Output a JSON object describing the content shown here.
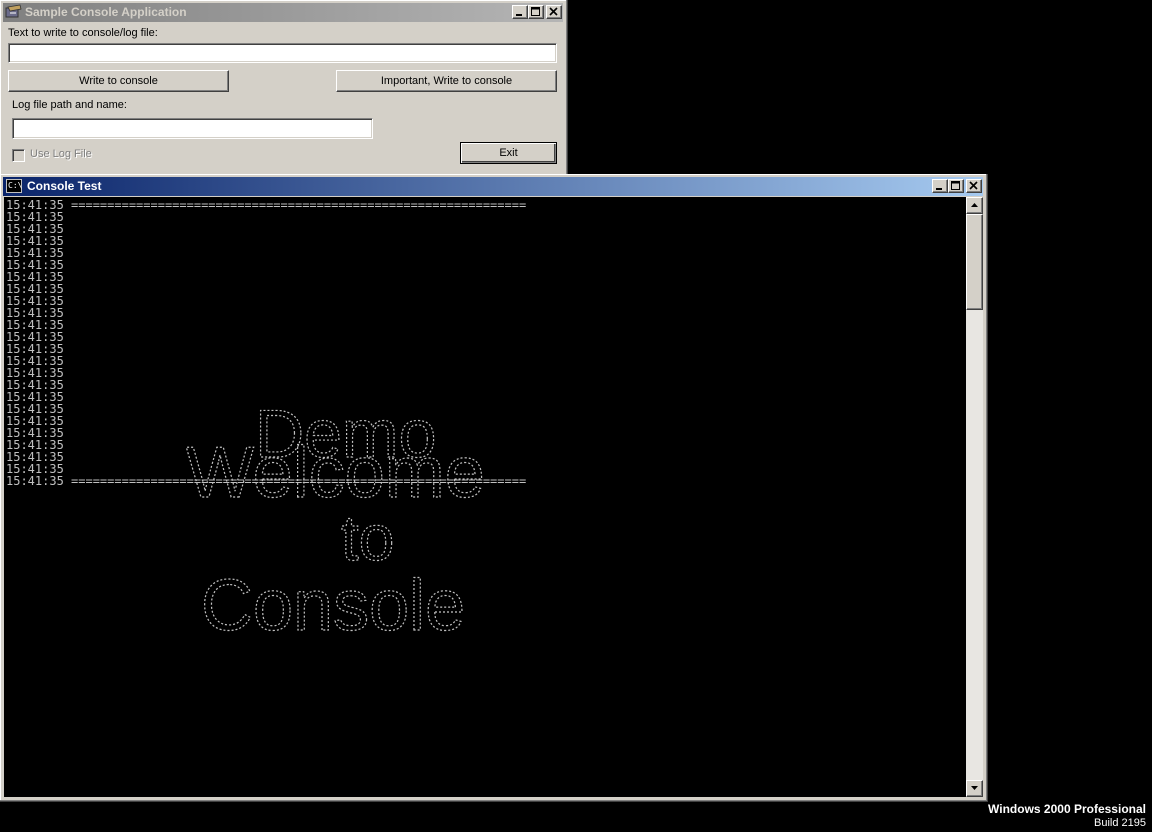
{
  "app_window": {
    "title": "Sample Console Application",
    "text_label": "Text to write to console/log file:",
    "text_value": "",
    "write_button": "Write to console",
    "important_button": "Important, Write to console",
    "log_path_label": "Log file path and name:",
    "log_path_value": "",
    "use_log_label": "Use Log File",
    "use_log_checked": false,
    "exit_button": "Exit"
  },
  "console_window": {
    "title": "Console Test",
    "icon_text": "C:\\",
    "timestamp": "15:41:35",
    "line_count": 24,
    "separator": "===============================================================================",
    "banner_words": [
      "Welcome",
      "to",
      "Console",
      "Demo"
    ]
  },
  "watermark": {
    "line1": "Windows 2000 Professional",
    "line2": "Build 2195"
  },
  "colors": {
    "console_bg": "#000000",
    "console_text": "#c0c0c0",
    "active_title_start": "#0a246a",
    "active_title_end": "#a6caf0",
    "inactive_title_start": "#808080",
    "face": "#d4d0c8"
  }
}
